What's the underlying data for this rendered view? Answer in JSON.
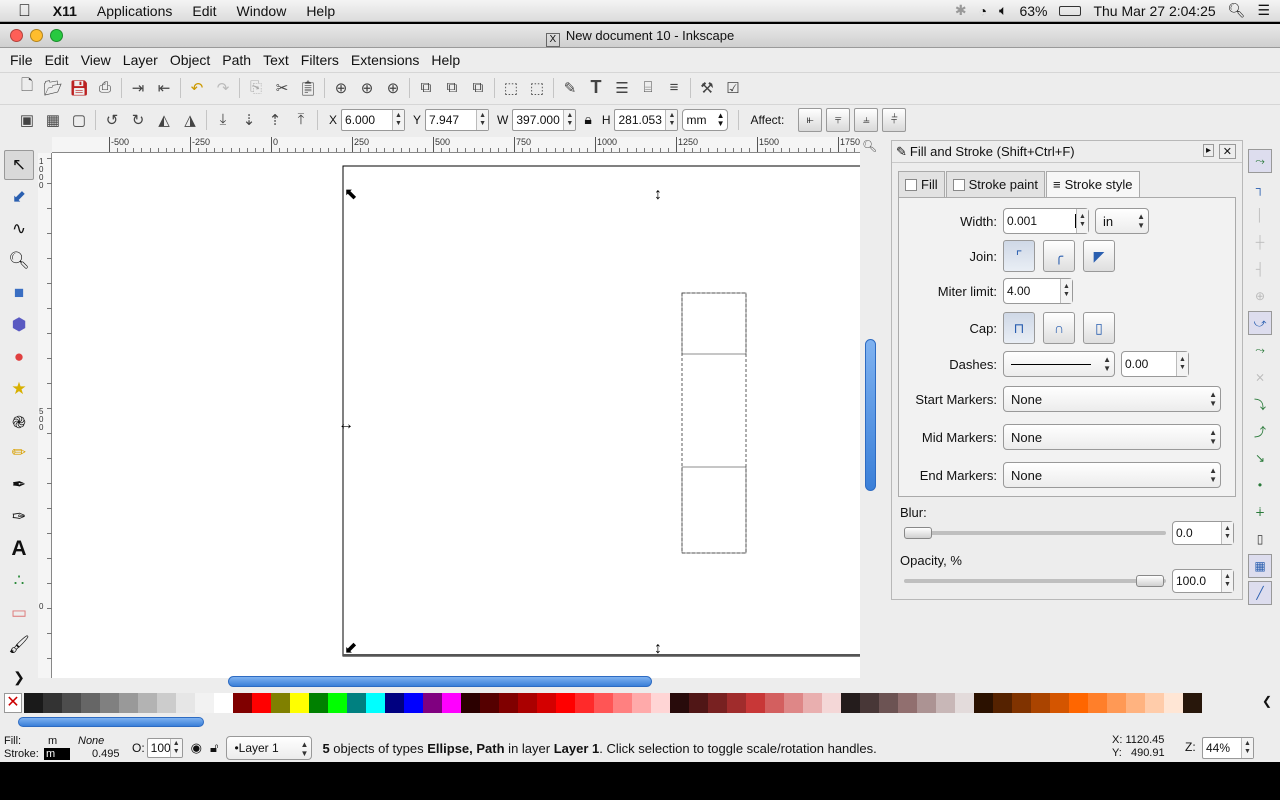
{
  "mac_menubar": {
    "app": "X11",
    "items": [
      "Applications",
      "Edit",
      "Window",
      "Help"
    ],
    "battery": "63%",
    "clock": "Thu Mar 27  2:04:25"
  },
  "window": {
    "title": "New document 10 - Inkscape"
  },
  "menu": {
    "items": [
      "File",
      "Edit",
      "View",
      "Layer",
      "Object",
      "Path",
      "Text",
      "Filters",
      "Extensions",
      "Help"
    ]
  },
  "toolcontrols": {
    "x_label": "X",
    "x_value": "6.000",
    "y_label": "Y",
    "y_value": "7.947",
    "w_label": "W",
    "w_value": "397.000",
    "h_label": "H",
    "h_value": "281.053",
    "unit": "mm",
    "affect_label": "Affect:"
  },
  "ruler": {
    "h_ticks": [
      "-500",
      "-250",
      "0",
      "250",
      "500",
      "750",
      "1000",
      "1250",
      "1500",
      "1750"
    ],
    "v_ticks": [
      "1000",
      "500",
      "0"
    ]
  },
  "dialog": {
    "title": "Fill and Stroke (Shift+Ctrl+F)",
    "tabs": [
      "Fill",
      "Stroke paint",
      "Stroke style"
    ],
    "active_tab": "Stroke style",
    "width_label": "Width:",
    "width_value": "0.001",
    "width_unit": "in",
    "join_label": "Join:",
    "miter_label": "Miter limit:",
    "miter_value": "4.00",
    "cap_label": "Cap:",
    "dashes_label": "Dashes:",
    "dash_offset": "0.00",
    "start_markers_label": "Start Markers:",
    "start_markers_value": "None",
    "mid_markers_label": "Mid Markers:",
    "mid_markers_value": "None",
    "end_markers_label": "End Markers:",
    "end_markers_value": "None",
    "blur_label": "Blur:",
    "blur_value": "0.0",
    "opacity_label": "Opacity, %",
    "opacity_value": "100.0"
  },
  "status": {
    "fill_label": "Fill:",
    "fill_value": "m",
    "fill_none": "None",
    "stroke_label": "Stroke:",
    "stroke_value": "m",
    "stroke_width": "0.495",
    "opacity_label": "O:",
    "opacity_value": "100",
    "layer": "•Layer 1",
    "message_count": "5",
    "message_pre": " objects of types ",
    "message_types": "Ellipse, Path",
    "message_mid": " in layer ",
    "message_layer": "Layer 1",
    "message_post": ". Click selection to toggle scale/rotation handles.",
    "x_coord": "X: 1120.45",
    "y_coord": "Y:   490.91",
    "zoom_label": "Z:",
    "zoom_value": "44%"
  },
  "palette_colors": [
    "#1a1a1a",
    "#333333",
    "#4d4d4d",
    "#666666",
    "#808080",
    "#999999",
    "#b3b3b3",
    "#cccccc",
    "#e6e6e6",
    "#f2f2f2",
    "#ffffff",
    "#800000",
    "#ff0000",
    "#808000",
    "#ffff00",
    "#008000",
    "#00ff00",
    "#008080",
    "#00ffff",
    "#000080",
    "#0000ff",
    "#800080",
    "#ff00ff",
    "#2b0000",
    "#550000",
    "#800000",
    "#aa0000",
    "#d40000",
    "#ff0000",
    "#ff2a2a",
    "#ff5555",
    "#ff8080",
    "#ffaaaa",
    "#ffd5d5",
    "#280b0b",
    "#501616",
    "#782121",
    "#a02c2c",
    "#c83737",
    "#d35f5f",
    "#de8787",
    "#e9afaf",
    "#f4d7d7",
    "#241c1c",
    "#483737",
    "#6c5353",
    "#916f6f",
    "#ac9393",
    "#c8b7b7",
    "#e3dbdb",
    "#2b1100",
    "#552200",
    "#803300",
    "#aa4400",
    "#d45500",
    "#ff6600",
    "#ff7f2a",
    "#ff9955",
    "#ffb380",
    "#ffccaa",
    "#ffe6d5",
    "#28170b"
  ]
}
